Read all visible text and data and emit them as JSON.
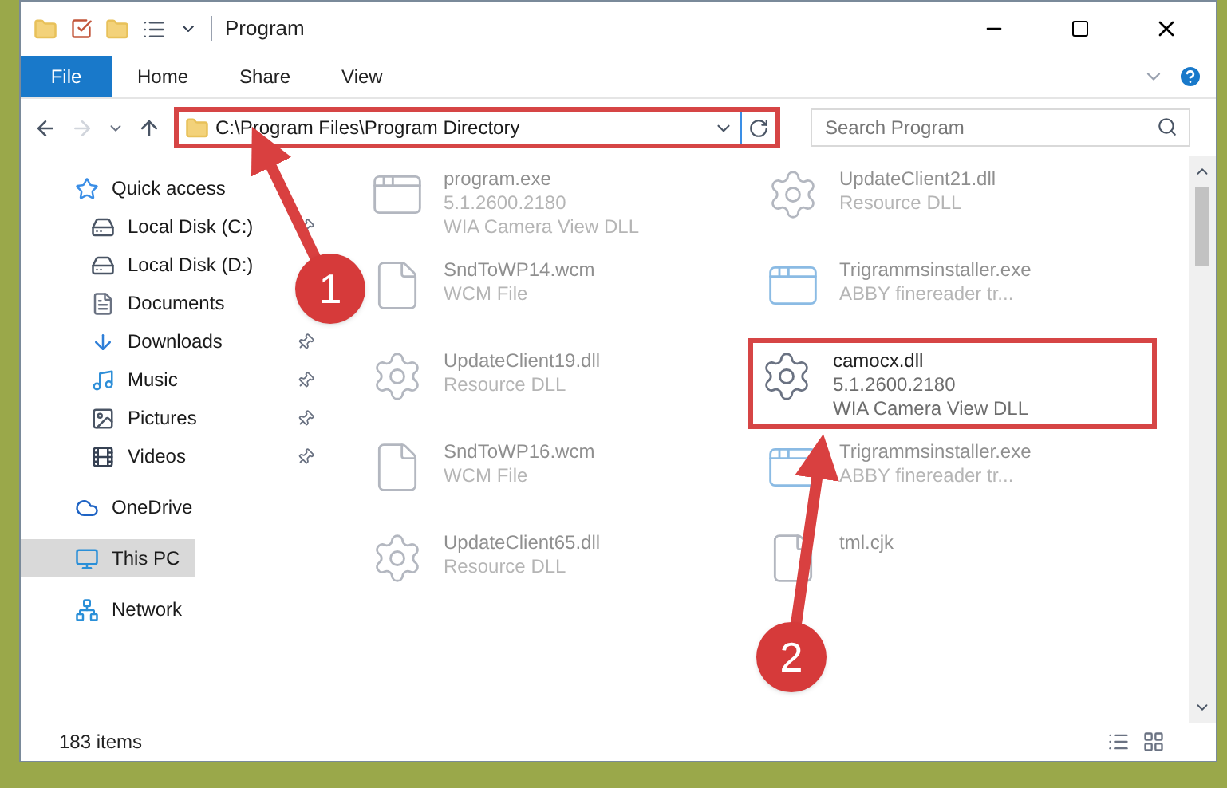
{
  "window": {
    "title": "Program"
  },
  "ribbon": {
    "tabs": [
      {
        "label": "File",
        "selected": true
      },
      {
        "label": "Home",
        "selected": false
      },
      {
        "label": "Share",
        "selected": false
      },
      {
        "label": "View",
        "selected": false
      }
    ]
  },
  "address_bar": {
    "path": "C:\\Program Files\\Program Directory",
    "highlighted": true
  },
  "search": {
    "placeholder": "Search Program"
  },
  "sidebar": {
    "items": [
      {
        "label": "Quick access",
        "kind": "star",
        "pinned": false,
        "selected": false,
        "children": [
          {
            "label": "Local Disk (C:)",
            "kind": "disk",
            "pinned": true,
            "selected": false
          },
          {
            "label": "Local Disk (D:)",
            "kind": "disk",
            "pinned": false,
            "selected": false
          },
          {
            "label": "Documents",
            "kind": "documents",
            "pinned": false,
            "selected": false
          },
          {
            "label": "Downloads",
            "kind": "downloads",
            "pinned": true,
            "selected": false
          },
          {
            "label": "Music",
            "kind": "music",
            "pinned": true,
            "selected": false
          },
          {
            "label": "Pictures",
            "kind": "pictures",
            "pinned": true,
            "selected": false
          },
          {
            "label": "Videos",
            "kind": "videos",
            "pinned": true,
            "selected": false
          }
        ]
      },
      {
        "label": "OneDrive",
        "kind": "cloud",
        "pinned": false,
        "selected": false
      },
      {
        "label": "This PC",
        "kind": "pc",
        "pinned": false,
        "selected": true
      },
      {
        "label": "Network",
        "kind": "network",
        "pinned": false,
        "selected": false
      }
    ]
  },
  "files": [
    {
      "name": "program.exe",
      "lines": [
        "5.1.2600.2180",
        "WIA Camera View DLL"
      ],
      "kind": "exe",
      "blurred": true,
      "highlighted": false
    },
    {
      "name": "UpdateClient21.dll",
      "lines": [
        "Resource DLL"
      ],
      "kind": "dll",
      "blurred": true,
      "highlighted": false
    },
    {
      "name": "SndToWP14.wcm",
      "lines": [
        "WCM File"
      ],
      "kind": "file",
      "blurred": true,
      "highlighted": false
    },
    {
      "name": "Trigrammsinstaller.exe",
      "lines": [
        "ABBY finereader tr..."
      ],
      "kind": "installer",
      "blurred": true,
      "highlighted": false
    },
    {
      "name": "UpdateClient19.dll",
      "lines": [
        "Resource DLL"
      ],
      "kind": "dll",
      "blurred": true,
      "highlighted": false
    },
    {
      "name": "camocx.dll",
      "lines": [
        "5.1.2600.2180",
        "WIA Camera View DLL"
      ],
      "kind": "dll",
      "blurred": false,
      "highlighted": true
    },
    {
      "name": "SndToWP16.wcm",
      "lines": [
        "WCM File"
      ],
      "kind": "file",
      "blurred": true,
      "highlighted": false
    },
    {
      "name": "Trigrammsinstaller.exe",
      "lines": [
        "ABBY finereader tr..."
      ],
      "kind": "installer",
      "blurred": true,
      "highlighted": false
    },
    {
      "name": "UpdateClient65.dll",
      "lines": [
        "Resource DLL"
      ],
      "kind": "dll",
      "blurred": true,
      "highlighted": false
    },
    {
      "name": "tml.cjk",
      "kind": "file",
      "blurred": true,
      "highlighted": false
    }
  ],
  "status_bar": {
    "count": "183 items"
  },
  "annotations": [
    {
      "number": "1"
    },
    {
      "number": "2"
    }
  ]
}
